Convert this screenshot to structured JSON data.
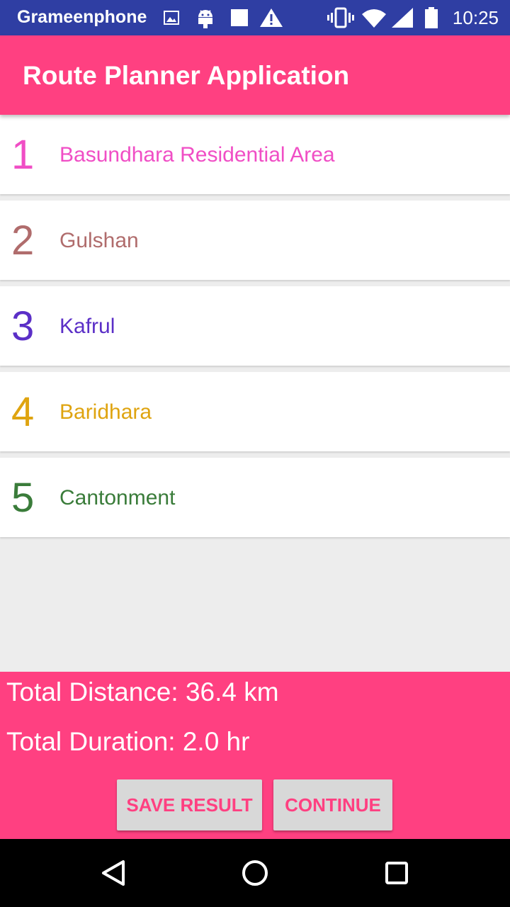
{
  "status_bar": {
    "carrier": "Grameenphone",
    "time": "10:25",
    "icons": [
      "image-icon",
      "android-icon",
      "square-notification-icon",
      "warning-icon",
      "vibrate-icon",
      "wifi-icon",
      "signal-icon",
      "battery-icon"
    ]
  },
  "app_bar": {
    "title": "Route Planner Application",
    "color": "#ff4081"
  },
  "route": {
    "stops": [
      {
        "number": "1",
        "name": "Basundhara Residential Area",
        "color": "#f04ec5"
      },
      {
        "number": "2",
        "name": "Gulshan",
        "color": "#b06c6c"
      },
      {
        "number": "3",
        "name": "Kafrul",
        "color": "#5b2fc7"
      },
      {
        "number": "4",
        "name": "Baridhara",
        "color": "#dfa410"
      },
      {
        "number": "5",
        "name": "Cantonment",
        "color": "#3a7c3a"
      }
    ]
  },
  "summary": {
    "total_distance": "Total Distance: 36.4 km",
    "total_duration": "Total Duration: 2.0 hr",
    "save_label": "SAVE RESULT",
    "continue_label": "CONTINUE"
  },
  "nav_bar": {
    "icons": [
      "back-icon",
      "home-icon",
      "recents-icon"
    ]
  }
}
